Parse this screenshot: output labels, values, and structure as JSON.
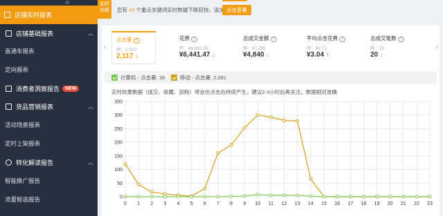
{
  "sidebar": {
    "active": {
      "label": "店铺实时报表"
    },
    "items": [
      {
        "type": "section",
        "label": "店铺基础报表",
        "icon": "doc-icon",
        "expanded": true
      },
      {
        "type": "sub",
        "label": "直通车报表"
      },
      {
        "type": "sub",
        "label": "定向报表"
      },
      {
        "type": "section",
        "label": "消费者洞察报告",
        "icon": "doc-icon",
        "badge": "NEW"
      },
      {
        "type": "section",
        "label": "货品营销报表",
        "icon": "doc-icon",
        "expanded": true
      },
      {
        "type": "sub",
        "label": "活动场景报表"
      },
      {
        "type": "sub",
        "label": "定时上架报表"
      },
      {
        "type": "section",
        "label": "转化解读报告",
        "icon": "circle-icon",
        "expanded": true
      },
      {
        "type": "sub",
        "label": "智能推广报告"
      },
      {
        "type": "sub",
        "label": "流量智选报告"
      }
    ]
  },
  "alert": {
    "tag": "实时诊断",
    "text_pre": "您有",
    "count": "43",
    "text_post": "个重点关键词实时数据下跌较快，请关注！",
    "button": "点击查看"
  },
  "kpis": [
    {
      "title": "点击量",
      "yesterday": "昨：2,537",
      "value": "2,117",
      "trend": "↓",
      "selected": true,
      "help": "?"
    },
    {
      "title": "花费",
      "yesterday": "昨：¥6,892.09",
      "value": "¥6,441.47",
      "trend": "↓",
      "selected": false,
      "help": "?"
    },
    {
      "title": "总成交金额",
      "yesterday": "昨：¥7,295",
      "value": "¥4,840",
      "trend": "↓",
      "selected": false,
      "help": "?"
    },
    {
      "title": "平均点击花费",
      "yesterday": "昨：¥2.72",
      "value": "¥3.04",
      "trend": "↑",
      "selected": false,
      "help": "?"
    },
    {
      "title": "总成交笔数",
      "yesterday": "昨：25",
      "value": "20",
      "trend": "↓",
      "selected": false,
      "help": "?"
    }
  ],
  "legend": [
    {
      "label": "计算机 - 点击量: 36",
      "color": "#7dc855"
    },
    {
      "label": "移动 - 点击量: 2,081",
      "color": "#d4a017"
    }
  ],
  "note": "实时效果数据（成交、收藏、加购）将会在点击后持续产生，建议2-3小时后再关注，数据相对准确",
  "chart_data": {
    "type": "line",
    "x": [
      0,
      1,
      2,
      3,
      4,
      5,
      6,
      7,
      8,
      9,
      10,
      11,
      12,
      13,
      14,
      15,
      16,
      17,
      18,
      19,
      20,
      21,
      22,
      23
    ],
    "series": [
      {
        "name": "移动 - 点击量",
        "color": "#d4a017",
        "values": [
          120,
          45,
          17,
          10,
          5,
          2,
          30,
          160,
          190,
          253,
          300,
          292,
          280,
          278,
          65,
          0,
          0,
          0,
          0,
          0,
          0,
          0,
          0,
          0
        ]
      },
      {
        "name": "计算机 - 点击量",
        "color": "#7dc855",
        "values": [
          0,
          0,
          0,
          0,
          0,
          0,
          0,
          0,
          1,
          2,
          8,
          5,
          5,
          5,
          2,
          0,
          0,
          0,
          0,
          0,
          0,
          0,
          0,
          0
        ]
      }
    ],
    "ylim": [
      0,
      350
    ],
    "yticks": [
      0,
      50,
      100,
      150,
      200,
      250,
      300,
      350
    ],
    "grid": true
  }
}
